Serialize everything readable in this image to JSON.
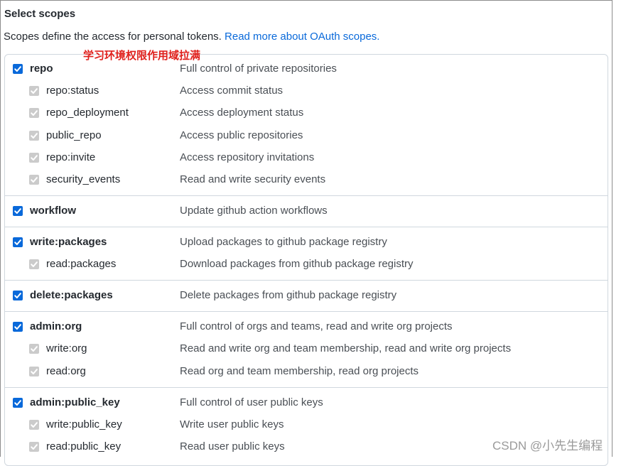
{
  "heading": "Select scopes",
  "description": {
    "text": "Scopes define the access for personal tokens. ",
    "link": "Read more about OAuth scopes."
  },
  "annotation": "学习环境权限作用域拉满",
  "colors": {
    "accent": "#0969da",
    "annotation": "#e0201c",
    "checkbox_child": "#cbcbcb"
  },
  "scopes": [
    {
      "name": "repo",
      "desc": "Full control of private repositories",
      "parent": true,
      "checked": true
    },
    {
      "name": "repo:status",
      "desc": "Access commit status",
      "parent": false,
      "checked": true
    },
    {
      "name": "repo_deployment",
      "desc": "Access deployment status",
      "parent": false,
      "checked": true
    },
    {
      "name": "public_repo",
      "desc": "Access public repositories",
      "parent": false,
      "checked": true
    },
    {
      "name": "repo:invite",
      "desc": "Access repository invitations",
      "parent": false,
      "checked": true
    },
    {
      "name": "security_events",
      "desc": "Read and write security events",
      "parent": false,
      "checked": true
    },
    {
      "name": "workflow",
      "desc": "Update github action workflows",
      "parent": true,
      "checked": true
    },
    {
      "name": "write:packages",
      "desc": "Upload packages to github package registry",
      "parent": true,
      "checked": true
    },
    {
      "name": "read:packages",
      "desc": "Download packages from github package registry",
      "parent": false,
      "checked": true
    },
    {
      "name": "delete:packages",
      "desc": "Delete packages from github package registry",
      "parent": true,
      "checked": true
    },
    {
      "name": "admin:org",
      "desc": "Full control of orgs and teams, read and write org projects",
      "parent": true,
      "checked": true
    },
    {
      "name": "write:org",
      "desc": "Read and write org and team membership, read and write org projects",
      "parent": false,
      "checked": true
    },
    {
      "name": "read:org",
      "desc": "Read org and team membership, read org projects",
      "parent": false,
      "checked": true
    },
    {
      "name": "admin:public_key",
      "desc": "Full control of user public keys",
      "parent": true,
      "checked": true
    },
    {
      "name": "write:public_key",
      "desc": "Write user public keys",
      "parent": false,
      "checked": true
    },
    {
      "name": "read:public_key",
      "desc": "Read user public keys",
      "parent": false,
      "checked": true
    }
  ],
  "watermark": "CSDN @小先生编程"
}
